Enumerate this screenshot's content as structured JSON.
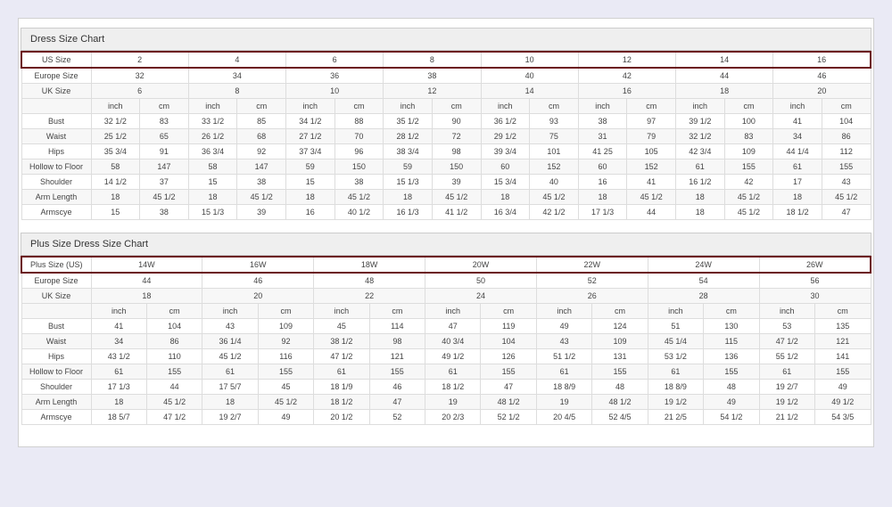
{
  "chart1": {
    "title": "Dress Size Chart",
    "primary": {
      "label": "US Size",
      "values": [
        "2",
        "4",
        "6",
        "8",
        "10",
        "12",
        "14",
        "16"
      ]
    },
    "rowsSpan": [
      {
        "label": "Europe Size",
        "values": [
          "32",
          "34",
          "36",
          "38",
          "40",
          "42",
          "44",
          "46"
        ]
      },
      {
        "label": "UK Size",
        "values": [
          "6",
          "8",
          "10",
          "12",
          "14",
          "16",
          "18",
          "20"
        ]
      }
    ],
    "unitHeaders": [
      "inch",
      "cm",
      "inch",
      "cm",
      "inch",
      "cm",
      "inch",
      "cm",
      "inch",
      "cm",
      "inch",
      "cm",
      "inch",
      "cm",
      "inch",
      "cm"
    ],
    "measurements": [
      {
        "label": "Bust",
        "values": [
          "32 1/2",
          "83",
          "33 1/2",
          "85",
          "34 1/2",
          "88",
          "35 1/2",
          "90",
          "36 1/2",
          "93",
          "38",
          "97",
          "39 1/2",
          "100",
          "41",
          "104"
        ]
      },
      {
        "label": "Waist",
        "values": [
          "25 1/2",
          "65",
          "26 1/2",
          "68",
          "27 1/2",
          "70",
          "28 1/2",
          "72",
          "29 1/2",
          "75",
          "31",
          "79",
          "32 1/2",
          "83",
          "34",
          "86"
        ]
      },
      {
        "label": "Hips",
        "values": [
          "35 3/4",
          "91",
          "36 3/4",
          "92",
          "37 3/4",
          "96",
          "38 3/4",
          "98",
          "39 3/4",
          "101",
          "41 25",
          "105",
          "42 3/4",
          "109",
          "44 1/4",
          "112"
        ]
      },
      {
        "label": "Hollow to Floor",
        "values": [
          "58",
          "147",
          "58",
          "147",
          "59",
          "150",
          "59",
          "150",
          "60",
          "152",
          "60",
          "152",
          "61",
          "155",
          "61",
          "155"
        ]
      },
      {
        "label": "Shoulder",
        "values": [
          "14 1/2",
          "37",
          "15",
          "38",
          "15",
          "38",
          "15 1/3",
          "39",
          "15 3/4",
          "40",
          "16",
          "41",
          "16 1/2",
          "42",
          "17",
          "43"
        ]
      },
      {
        "label": "Arm Length",
        "values": [
          "18",
          "45 1/2",
          "18",
          "45 1/2",
          "18",
          "45 1/2",
          "18",
          "45 1/2",
          "18",
          "45 1/2",
          "18",
          "45 1/2",
          "18",
          "45 1/2",
          "18",
          "45 1/2"
        ]
      },
      {
        "label": "Armscye",
        "values": [
          "15",
          "38",
          "15 1/3",
          "39",
          "16",
          "40 1/2",
          "16 1/3",
          "41 1/2",
          "16 3/4",
          "42 1/2",
          "17 1/3",
          "44",
          "18",
          "45 1/2",
          "18 1/2",
          "47"
        ]
      }
    ]
  },
  "chart2": {
    "title": "Plus Size Dress Size Chart",
    "primary": {
      "label": "Plus Size (US)",
      "values": [
        "14W",
        "16W",
        "18W",
        "20W",
        "22W",
        "24W",
        "26W"
      ]
    },
    "rowsSpan": [
      {
        "label": "Europe Size",
        "values": [
          "44",
          "46",
          "48",
          "50",
          "52",
          "54",
          "56"
        ]
      },
      {
        "label": "UK Size",
        "values": [
          "18",
          "20",
          "22",
          "24",
          "26",
          "28",
          "30"
        ]
      }
    ],
    "unitHeaders": [
      "inch",
      "cm",
      "inch",
      "cm",
      "inch",
      "cm",
      "inch",
      "cm",
      "inch",
      "cm",
      "inch",
      "cm",
      "inch",
      "cm"
    ],
    "measurements": [
      {
        "label": "Bust",
        "values": [
          "41",
          "104",
          "43",
          "109",
          "45",
          "114",
          "47",
          "119",
          "49",
          "124",
          "51",
          "130",
          "53",
          "135"
        ]
      },
      {
        "label": "Waist",
        "values": [
          "34",
          "86",
          "36 1/4",
          "92",
          "38 1/2",
          "98",
          "40 3/4",
          "104",
          "43",
          "109",
          "45 1/4",
          "115",
          "47 1/2",
          "121"
        ]
      },
      {
        "label": "Hips",
        "values": [
          "43 1/2",
          "110",
          "45 1/2",
          "116",
          "47 1/2",
          "121",
          "49 1/2",
          "126",
          "51 1/2",
          "131",
          "53 1/2",
          "136",
          "55 1/2",
          "141"
        ]
      },
      {
        "label": "Hollow to Floor",
        "values": [
          "61",
          "155",
          "61",
          "155",
          "61",
          "155",
          "61",
          "155",
          "61",
          "155",
          "61",
          "155",
          "61",
          "155"
        ]
      },
      {
        "label": "Shoulder",
        "values": [
          "17 1/3",
          "44",
          "17 5/7",
          "45",
          "18 1/9",
          "46",
          "18 1/2",
          "47",
          "18 8/9",
          "48",
          "18 8/9",
          "48",
          "19 2/7",
          "49"
        ]
      },
      {
        "label": "Arm Length",
        "values": [
          "18",
          "45 1/2",
          "18",
          "45 1/2",
          "18 1/2",
          "47",
          "19",
          "48 1/2",
          "19",
          "48 1/2",
          "19 1/2",
          "49",
          "19 1/2",
          "49 1/2"
        ]
      },
      {
        "label": "Armscye",
        "values": [
          "18 5/7",
          "47 1/2",
          "19 2/7",
          "49",
          "20 1/2",
          "52",
          "20 2/3",
          "52 1/2",
          "20 4/5",
          "52 4/5",
          "21 2/5",
          "54 1/2",
          "21 1/2",
          "54 3/5"
        ]
      }
    ]
  },
  "chart_data": [
    {
      "type": "table",
      "title": "Dress Size Chart",
      "sizes_us": [
        "2",
        "4",
        "6",
        "8",
        "10",
        "12",
        "14",
        "16"
      ],
      "sizes_europe": [
        "32",
        "34",
        "36",
        "38",
        "40",
        "42",
        "44",
        "46"
      ],
      "sizes_uk": [
        "6",
        "8",
        "10",
        "12",
        "14",
        "16",
        "18",
        "20"
      ],
      "measurements_inch_cm": {
        "Bust": [
          [
            "32 1/2",
            "83"
          ],
          [
            "33 1/2",
            "85"
          ],
          [
            "34 1/2",
            "88"
          ],
          [
            "35 1/2",
            "90"
          ],
          [
            "36 1/2",
            "93"
          ],
          [
            "38",
            "97"
          ],
          [
            "39 1/2",
            "100"
          ],
          [
            "41",
            "104"
          ]
        ],
        "Waist": [
          [
            "25 1/2",
            "65"
          ],
          [
            "26 1/2",
            "68"
          ],
          [
            "27 1/2",
            "70"
          ],
          [
            "28 1/2",
            "72"
          ],
          [
            "29 1/2",
            "75"
          ],
          [
            "31",
            "79"
          ],
          [
            "32 1/2",
            "83"
          ],
          [
            "34",
            "86"
          ]
        ],
        "Hips": [
          [
            "35 3/4",
            "91"
          ],
          [
            "36 3/4",
            "92"
          ],
          [
            "37 3/4",
            "96"
          ],
          [
            "38 3/4",
            "98"
          ],
          [
            "39 3/4",
            "101"
          ],
          [
            "41 25",
            "105"
          ],
          [
            "42 3/4",
            "109"
          ],
          [
            "44 1/4",
            "112"
          ]
        ],
        "Hollow to Floor": [
          [
            "58",
            "147"
          ],
          [
            "58",
            "147"
          ],
          [
            "59",
            "150"
          ],
          [
            "59",
            "150"
          ],
          [
            "60",
            "152"
          ],
          [
            "60",
            "152"
          ],
          [
            "61",
            "155"
          ],
          [
            "61",
            "155"
          ]
        ],
        "Shoulder": [
          [
            "14 1/2",
            "37"
          ],
          [
            "15",
            "38"
          ],
          [
            "15",
            "38"
          ],
          [
            "15 1/3",
            "39"
          ],
          [
            "15 3/4",
            "40"
          ],
          [
            "16",
            "41"
          ],
          [
            "16 1/2",
            "42"
          ],
          [
            "17",
            "43"
          ]
        ],
        "Arm Length": [
          [
            "18",
            "45 1/2"
          ],
          [
            "18",
            "45 1/2"
          ],
          [
            "18",
            "45 1/2"
          ],
          [
            "18",
            "45 1/2"
          ],
          [
            "18",
            "45 1/2"
          ],
          [
            "18",
            "45 1/2"
          ],
          [
            "18",
            "45 1/2"
          ],
          [
            "18",
            "45 1/2"
          ]
        ],
        "Armscye": [
          [
            "15",
            "38"
          ],
          [
            "15 1/3",
            "39"
          ],
          [
            "16",
            "40 1/2"
          ],
          [
            "16 1/3",
            "41 1/2"
          ],
          [
            "16 3/4",
            "42 1/2"
          ],
          [
            "17 1/3",
            "44"
          ],
          [
            "18",
            "45 1/2"
          ],
          [
            "18 1/2",
            "47"
          ]
        ]
      }
    },
    {
      "type": "table",
      "title": "Plus Size Dress Size Chart",
      "sizes_us": [
        "14W",
        "16W",
        "18W",
        "20W",
        "22W",
        "24W",
        "26W"
      ],
      "sizes_europe": [
        "44",
        "46",
        "48",
        "50",
        "52",
        "54",
        "56"
      ],
      "sizes_uk": [
        "18",
        "20",
        "22",
        "24",
        "26",
        "28",
        "30"
      ],
      "measurements_inch_cm": {
        "Bust": [
          [
            "41",
            "104"
          ],
          [
            "43",
            "109"
          ],
          [
            "45",
            "114"
          ],
          [
            "47",
            "119"
          ],
          [
            "49",
            "124"
          ],
          [
            "51",
            "130"
          ],
          [
            "53",
            "135"
          ]
        ],
        "Waist": [
          [
            "34",
            "86"
          ],
          [
            "36 1/4",
            "92"
          ],
          [
            "38 1/2",
            "98"
          ],
          [
            "40 3/4",
            "104"
          ],
          [
            "43",
            "109"
          ],
          [
            "45 1/4",
            "115"
          ],
          [
            "47 1/2",
            "121"
          ]
        ],
        "Hips": [
          [
            "43 1/2",
            "110"
          ],
          [
            "45 1/2",
            "116"
          ],
          [
            "47 1/2",
            "121"
          ],
          [
            "49 1/2",
            "126"
          ],
          [
            "51 1/2",
            "131"
          ],
          [
            "53 1/2",
            "136"
          ],
          [
            "55 1/2",
            "141"
          ]
        ],
        "Hollow to Floor": [
          [
            "61",
            "155"
          ],
          [
            "61",
            "155"
          ],
          [
            "61",
            "155"
          ],
          [
            "61",
            "155"
          ],
          [
            "61",
            "155"
          ],
          [
            "61",
            "155"
          ],
          [
            "61",
            "155"
          ]
        ],
        "Shoulder": [
          [
            "17 1/3",
            "44"
          ],
          [
            "17 5/7",
            "45"
          ],
          [
            "18 1/9",
            "46"
          ],
          [
            "18 1/2",
            "47"
          ],
          [
            "18 8/9",
            "48"
          ],
          [
            "18 8/9",
            "48"
          ],
          [
            "19 2/7",
            "49"
          ]
        ],
        "Arm Length": [
          [
            "18",
            "45 1/2"
          ],
          [
            "18",
            "45 1/2"
          ],
          [
            "18 1/2",
            "47"
          ],
          [
            "19",
            "48 1/2"
          ],
          [
            "19",
            "48 1/2"
          ],
          [
            "19 1/2",
            "49"
          ],
          [
            "19 1/2",
            "49 1/2"
          ]
        ],
        "Armscye": [
          [
            "18 5/7",
            "47 1/2"
          ],
          [
            "19 2/7",
            "49"
          ],
          [
            "20 1/2",
            "52"
          ],
          [
            "20 2/3",
            "52 1/2"
          ],
          [
            "20 4/5",
            "52 4/5"
          ],
          [
            "21 2/5",
            "54 1/2"
          ],
          [
            "21 1/2",
            "54 3/5"
          ]
        ]
      }
    }
  ]
}
